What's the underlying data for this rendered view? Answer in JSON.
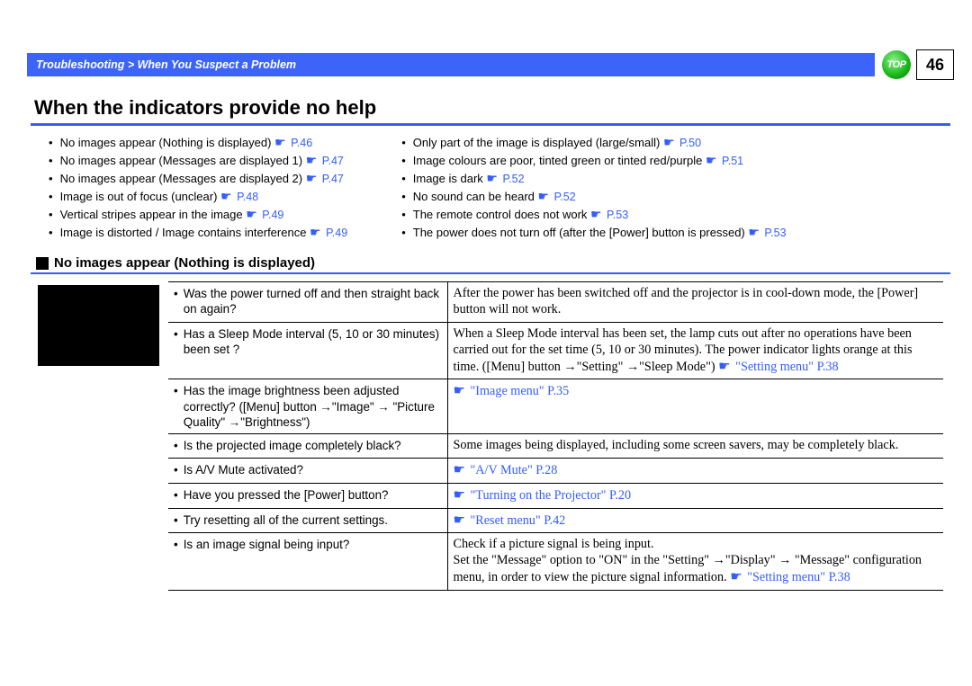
{
  "header": {
    "breadcrumb": "Troubleshooting > When You Suspect a Problem",
    "top_label": "TOP",
    "page_number": "46"
  },
  "title": "When the indicators provide no help",
  "link_columns": {
    "left": [
      {
        "text": "No images appear (Nothing is displayed)",
        "page": "P.46"
      },
      {
        "text": "No images appear (Messages are displayed 1)",
        "page": "P.47"
      },
      {
        "text": "No images appear (Messages are displayed 2)",
        "page": "P.47"
      },
      {
        "text": "Image is out of focus (unclear)",
        "page": "P.48"
      },
      {
        "text": "Vertical stripes appear in the image",
        "page": "P.49"
      },
      {
        "text": "Image is distorted / Image contains interference",
        "page": "P.49"
      }
    ],
    "right": [
      {
        "text": "Only part of the image is displayed (large/small)",
        "page": "P.50"
      },
      {
        "text": "Image colours are poor, tinted green or tinted red/purple",
        "page": "P.51"
      },
      {
        "text": "Image is dark",
        "page": "P.52"
      },
      {
        "text": "No sound can be heard",
        "page": "P.52"
      },
      {
        "text": "The remote control does not work",
        "page": "P.53"
      },
      {
        "text": "The power does not turn off (after the [Power] button is pressed)",
        "page": "P.53"
      }
    ]
  },
  "subheading": "No images appear (Nothing is displayed)",
  "table_rows": [
    {
      "q": "Was the power turned off and then straight back on again?",
      "a": "After the power has been switched off and the projector is in cool-down mode, the [Power] button will not work."
    },
    {
      "q": "Has a Sleep Mode interval (5, 10 or 30 minutes) been set ?",
      "a_pre": "When a Sleep Mode interval has been set, the lamp cuts out after no operations have been carried out for the set time (5, 10 or 30 minutes). The power indicator lights orange at this time. ([Menu] button →\"Setting\" →\"Sleep Mode\") ",
      "a_link": "\"Setting menu\" P.38"
    },
    {
      "q": "Has the image brightness been adjusted correctly? ([Menu] button →\"Image\" → \"Picture Quality\" →\"Brightness\")",
      "a_link_only": "\"Image menu\" P.35"
    },
    {
      "q": "Is the projected image completely black?",
      "a": "Some images being displayed, including some screen savers, may be completely black."
    },
    {
      "q": "Is A/V Mute activated?",
      "a_link_only": "\"A/V Mute\" P.28"
    },
    {
      "q": "Have you pressed the [Power] button?",
      "a_link_only": "\"Turning on the Projector\" P.20"
    },
    {
      "q": "Try resetting all of the current settings.",
      "a_link_only": "\"Reset menu\" P.42"
    },
    {
      "q": "Is an image signal being input?",
      "a_pre": "Check if a picture signal is being input.\nSet the \"Message\" option to \"ON\" in the \"Setting\" →\"Display\" → \"Message\" configuration menu, in order to view the picture signal information. ",
      "a_link": "\"Setting menu\" P.38"
    }
  ]
}
